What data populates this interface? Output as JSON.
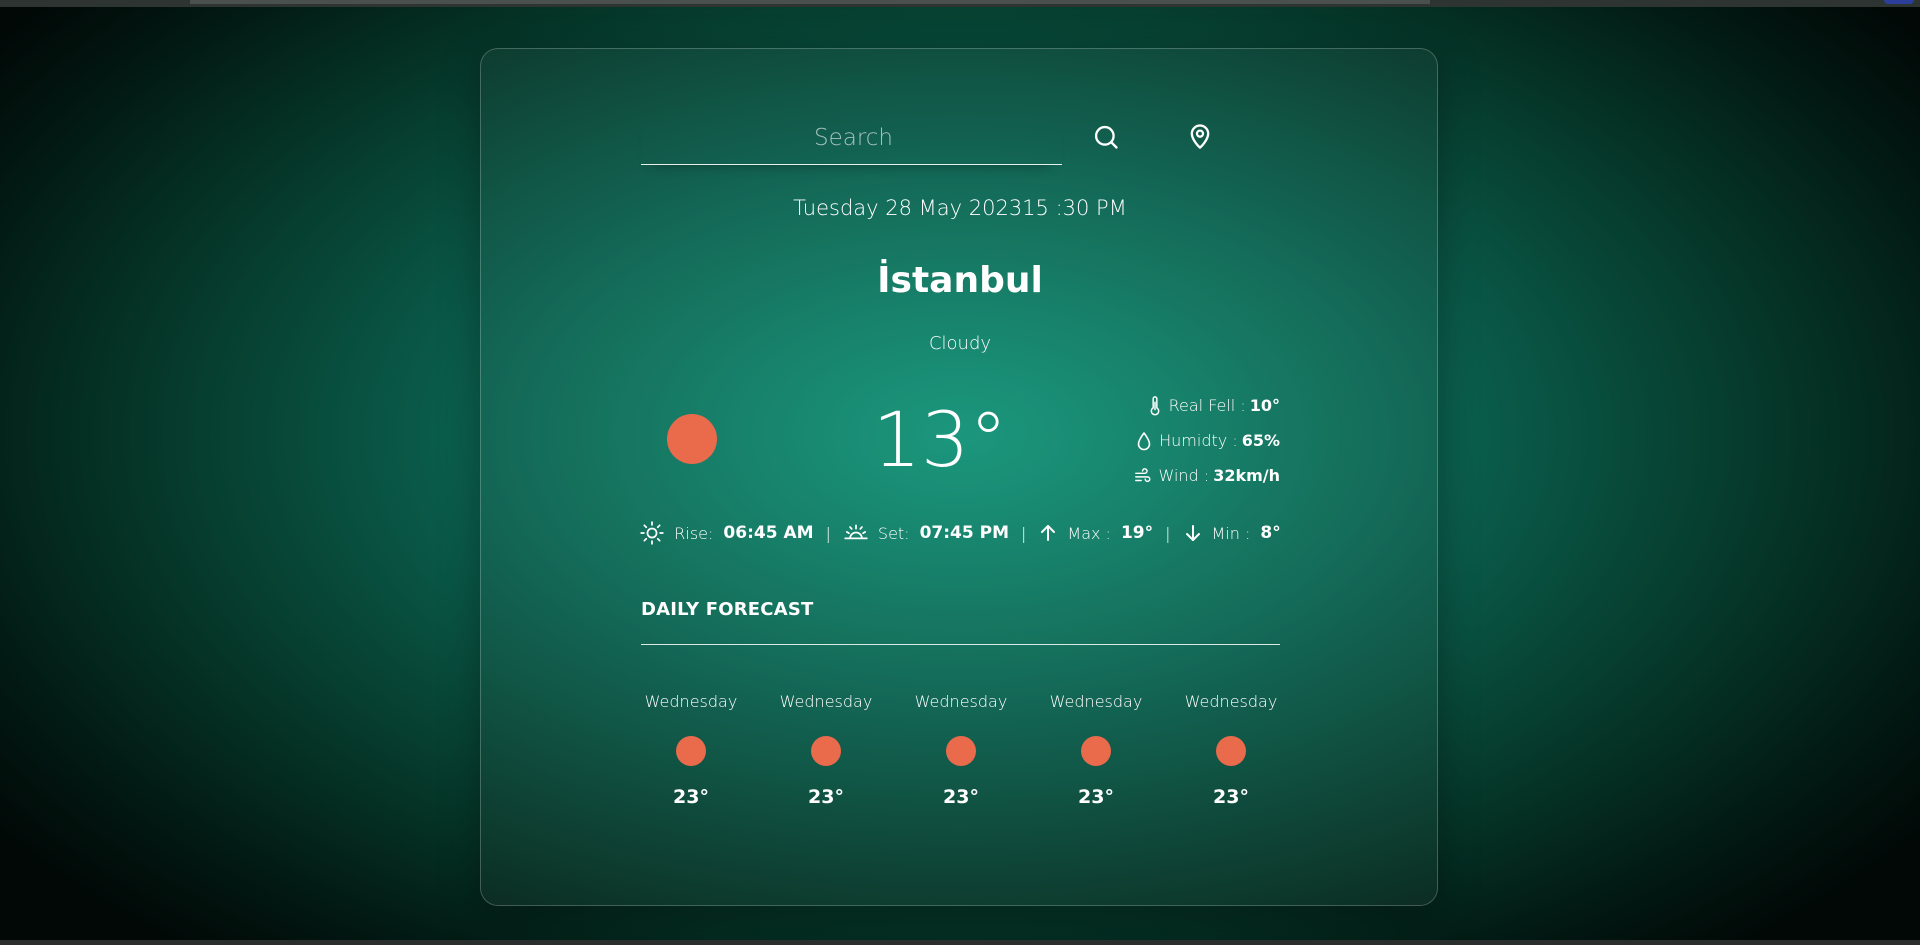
{
  "search": {
    "placeholder": "Search",
    "value": ""
  },
  "header": {
    "date_time": "Tuesday 28 May 202315 :30 PM",
    "city": "İstanbul",
    "condition": "Cloudy"
  },
  "current": {
    "temperature": "13°",
    "details": {
      "real_feel_label": "Real Fell :",
      "real_feel_value": "10°",
      "humidity_label": "Humidty :",
      "humidity_value": "65%",
      "wind_label": "Wind :",
      "wind_value": "32km/h"
    }
  },
  "sun": {
    "rise_label": "Rise:",
    "rise_value": "06:45 AM",
    "set_label": "Set:",
    "set_value": "07:45 PM",
    "max_label": "Max :",
    "max_value": "19°",
    "min_label": "Min :",
    "min_value": "8°",
    "separator": "|"
  },
  "forecast": {
    "title": "DAILY FORECAST",
    "items": [
      {
        "day": "Wednesday",
        "temp": "23°"
      },
      {
        "day": "Wednesday",
        "temp": "23°"
      },
      {
        "day": "Wednesday",
        "temp": "23°"
      },
      {
        "day": "Wednesday",
        "temp": "23°"
      },
      {
        "day": "Wednesday",
        "temp": "23°"
      }
    ]
  },
  "colors": {
    "weather_icon": "#ea6a4c",
    "background_center": "#139479",
    "background_edge": "#010806"
  },
  "icons": {
    "search": "search-icon",
    "location": "map-pin-icon",
    "weather": "weather-icon",
    "thermometer": "thermometer-icon",
    "humidity": "droplet-icon",
    "wind": "wind-icon",
    "sunrise": "sunrise-icon",
    "sunset": "sunset-icon",
    "max": "arrow-up-icon",
    "min": "arrow-down-icon"
  }
}
